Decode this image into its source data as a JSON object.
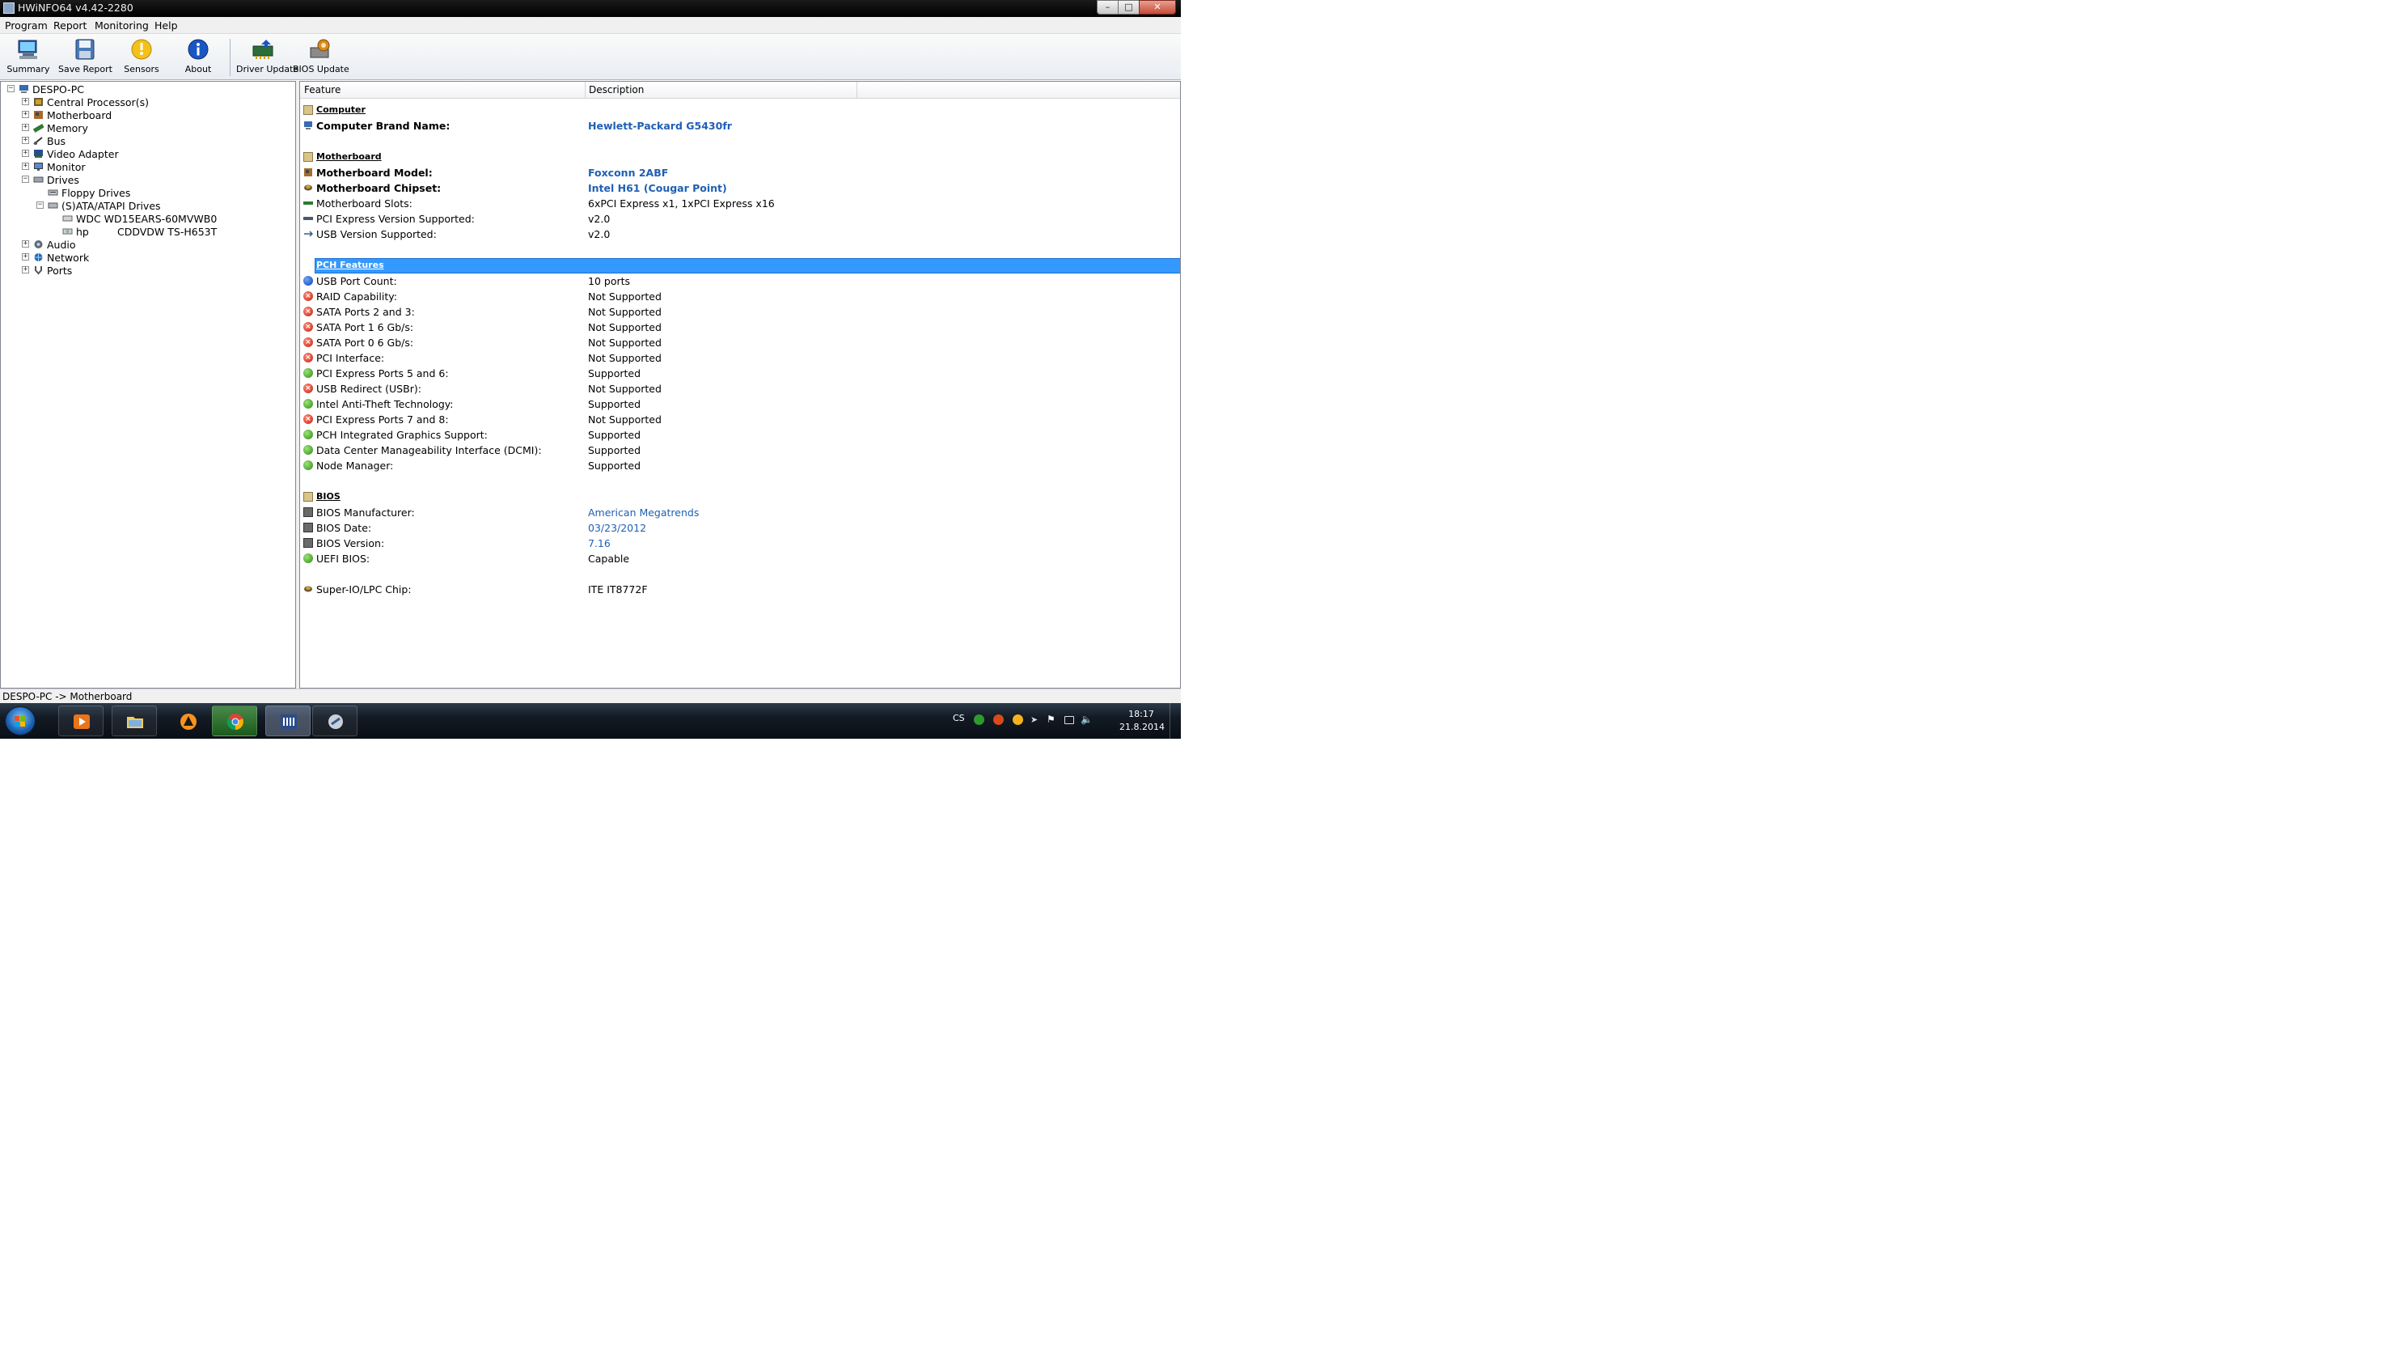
{
  "window": {
    "title": "HWiNFO64 v4.42-2280"
  },
  "menu": [
    "Program",
    "Report",
    "Monitoring",
    "Help"
  ],
  "toolbar": {
    "summary": "Summary",
    "save_report": "Save Report",
    "sensors": "Sensors",
    "about": "About",
    "driver_update": "Driver Update",
    "bios_update": "BIOS Update"
  },
  "tree": {
    "root": "DESPO-PC",
    "items": {
      "cpu": "Central Processor(s)",
      "motherboard": "Motherboard",
      "memory": "Memory",
      "bus": "Bus",
      "video": "Video Adapter",
      "monitor": "Monitor",
      "drives": "Drives",
      "floppy": "Floppy Drives",
      "sata": "(S)ATA/ATAPI Drives",
      "hdd": "WDC WD15EARS-60MVWB0",
      "odd_prefix": "hp",
      "odd": "CDDVDW TS-H653T",
      "audio": "Audio",
      "network": "Network",
      "ports": "Ports"
    }
  },
  "list": {
    "columns": {
      "feature": "Feature",
      "description": "Description"
    },
    "computer": {
      "section": "Computer",
      "brand_label": "Computer Brand Name:",
      "brand_value": "Hewlett-Packard G5430fr"
    },
    "motherboard": {
      "section": "Motherboard",
      "model_label": "Motherboard Model:",
      "model_value": "Foxconn 2ABF",
      "chipset_label": "Motherboard Chipset:",
      "chipset_value": "Intel H61 (Cougar Point)",
      "slots_label": "Motherboard Slots:",
      "slots_value": "6xPCI Express x1, 1xPCI Express x16",
      "pcie_label": "PCI Express Version Supported:",
      "pcie_value": "v2.0",
      "usb_label": "USB Version Supported:",
      "usb_value": "v2.0"
    },
    "pch": {
      "section": "PCH Features",
      "rows": [
        {
          "feature": "USB Port Count:",
          "value": "10 ports",
          "status": "info"
        },
        {
          "feature": "RAID Capability:",
          "value": "Not Supported",
          "status": "no"
        },
        {
          "feature": "SATA Ports 2 and 3:",
          "value": "Not Supported",
          "status": "no"
        },
        {
          "feature": "SATA Port 1 6 Gb/s:",
          "value": "Not Supported",
          "status": "no"
        },
        {
          "feature": "SATA Port 0 6 Gb/s:",
          "value": "Not Supported",
          "status": "no"
        },
        {
          "feature": "PCI Interface:",
          "value": "Not Supported",
          "status": "no"
        },
        {
          "feature": "PCI Express Ports 5 and 6:",
          "value": "Supported",
          "status": "ok"
        },
        {
          "feature": "USB Redirect (USBr):",
          "value": "Not Supported",
          "status": "no"
        },
        {
          "feature": "Intel Anti-Theft Technology:",
          "value": "Supported",
          "status": "ok"
        },
        {
          "feature": "PCI Express Ports 7 and 8:",
          "value": "Not Supported",
          "status": "no"
        },
        {
          "feature": "PCH Integrated Graphics Support:",
          "value": "Supported",
          "status": "ok"
        },
        {
          "feature": "Data Center Manageability Interface (DCMI):",
          "value": "Supported",
          "status": "ok"
        },
        {
          "feature": "Node Manager:",
          "value": "Supported",
          "status": "ok"
        }
      ]
    },
    "bios": {
      "section": "BIOS",
      "manufacturer_label": "BIOS Manufacturer:",
      "manufacturer_value": "American Megatrends",
      "date_label": "BIOS Date:",
      "date_value": "03/23/2012",
      "version_label": "BIOS Version:",
      "version_value": "7.16",
      "uefi_label": "UEFI BIOS:",
      "uefi_value": "Capable"
    },
    "superio": {
      "label": "Super-IO/LPC Chip:",
      "value": "ITE IT8772F"
    }
  },
  "status_bar": "DESPO-PC -> Motherboard",
  "taskbar": {
    "language": "CS",
    "time": "18:17",
    "date": "21.8.2014"
  },
  "colors": {
    "selection": "#3399ff",
    "link_value": "#1f5fb4",
    "supported": "#2e8a12",
    "not_supported": "#c21f10"
  }
}
